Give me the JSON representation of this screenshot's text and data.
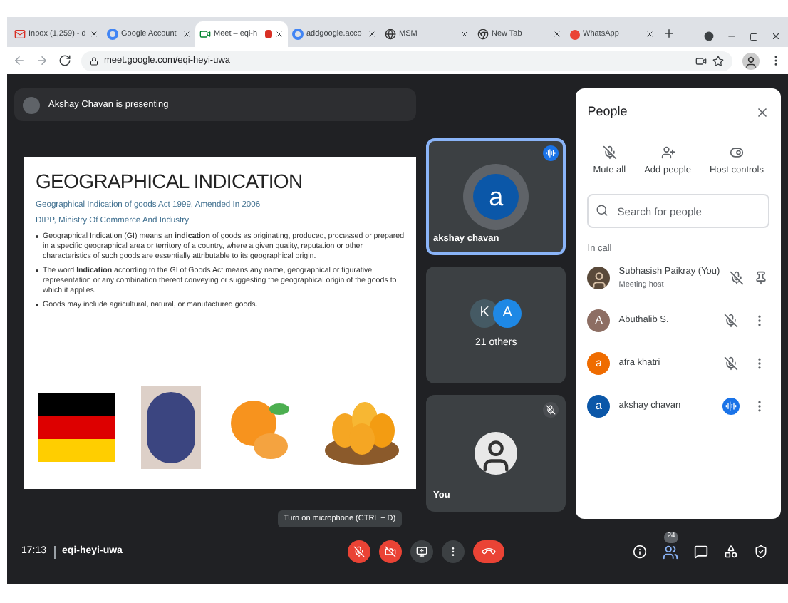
{
  "tabs": [
    {
      "label": "Inbox (1,259) - d",
      "selected": false,
      "recording": false
    },
    {
      "label": "Google Account",
      "selected": false,
      "recording": false
    },
    {
      "label": "Meet – eqi-h",
      "selected": true,
      "recording": true
    },
    {
      "label": "addgoogle.acco",
      "selected": false,
      "recording": false
    },
    {
      "label": "MSM",
      "selected": false,
      "recording": false
    },
    {
      "label": "New Tab",
      "selected": false,
      "recording": false
    },
    {
      "label": "WhatsApp",
      "selected": false,
      "recording": false
    }
  ],
  "address": "meet.google.com/eqi-heyi-uwa",
  "presenting": "Akshay Chavan is presenting",
  "slide": {
    "title": "GEOGRAPHICAL INDICATION",
    "subtitles": [
      "Geographical Indication of goods Act 1999, Amended In 2006",
      "DIPP, Ministry Of Commerce And Industry"
    ],
    "bullets": [
      "Geographical Indication (GI) means an **indication** of goods as originating, produced, processed or prepared in a specific geographical area or territory of a country, where a given quality, reputation or other characteristics of such goods are essentially attributable to its geographical origin.",
      "The word **Indication** according to the GI of Goods Act means any name, geographical or figurative representation or any combination thereof conveying or suggesting the geographical origin of the goods to which it applies.",
      "Goods may include agricultural, natural, or manufactured goods."
    ]
  },
  "tiles": [
    {
      "kind": "avatar",
      "letter": "a",
      "name": "akshay chavan",
      "speaking": true,
      "muted": false
    },
    {
      "kind": "group",
      "letters": [
        "K",
        "A"
      ],
      "name": "21 others",
      "speaking": false,
      "muted": false
    },
    {
      "kind": "photo",
      "name": "You",
      "speaking": false,
      "muted": true
    }
  ],
  "people": {
    "title": "People",
    "actions": [
      {
        "label": "Mute all"
      },
      {
        "label": "Add people"
      },
      {
        "label": "Host controls"
      }
    ],
    "search": {
      "placeholder": "Search for people"
    },
    "section": "In call",
    "members": [
      {
        "kind": "self",
        "name": "Subhasish Paikray (You)",
        "subtitle": "Meeting host",
        "muted": true,
        "speaking": false
      },
      {
        "kind": "guest",
        "name": "Abuthalib S.",
        "letter": "A",
        "color": "#8d6e63",
        "muted": true,
        "speaking": false
      },
      {
        "kind": "guest",
        "name": "afra khatri",
        "letter": "a",
        "color": "#ef6c00",
        "muted": true,
        "speaking": false
      },
      {
        "kind": "guest",
        "name": "akshay chavan",
        "letter": "a",
        "color": "#0b57a8",
        "speaking": true
      }
    ]
  },
  "tooltip": "Turn on microphone (CTRL + D)",
  "time": "17:13",
  "meeting_code": "eqi-heyi-uwa",
  "controls": {
    "mic_on": false,
    "camera_on": false
  },
  "people_count": "24"
}
